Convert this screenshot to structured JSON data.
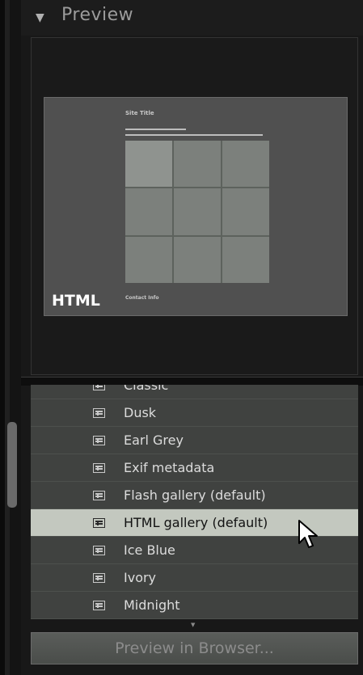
{
  "panel": {
    "title": "Preview",
    "collapse_glyph": "▼"
  },
  "preview": {
    "badge": "HTML",
    "site_title": "Site Title",
    "contact_info": "Contact Info"
  },
  "templates": [
    {
      "label": "Classic",
      "icon": "template-icon"
    },
    {
      "label": "Dusk",
      "icon": "template-icon"
    },
    {
      "label": "Earl Grey",
      "icon": "template-icon"
    },
    {
      "label": "Exif metadata",
      "icon": "template-icon"
    },
    {
      "label": "Flash gallery (default)",
      "icon": "template-icon"
    },
    {
      "label": "HTML gallery (default)",
      "icon": "template-icon",
      "selected": true
    },
    {
      "label": "Ice Blue",
      "icon": "template-icon"
    },
    {
      "label": "Ivory",
      "icon": "template-icon"
    },
    {
      "label": "Midnight",
      "icon": "template-icon"
    }
  ],
  "actions": {
    "preview_browser": "Preview in Browser..."
  },
  "colors": {
    "selected_row": "#c3c8bf",
    "list_bg": "#404240"
  }
}
